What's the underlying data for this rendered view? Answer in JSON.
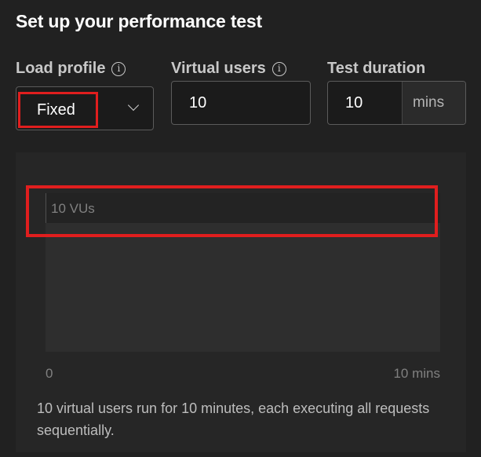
{
  "header": {
    "title": "Set up your performance test"
  },
  "load_profile": {
    "label": "Load profile",
    "info_icon": "info-icon",
    "selected": "Fixed",
    "dropdown_icon": "chevron-down-icon"
  },
  "virtual_users": {
    "label": "Virtual users",
    "info_icon": "info-icon",
    "value": "10"
  },
  "test_duration": {
    "label": "Test duration",
    "value": "10",
    "unit": "mins"
  },
  "chart": {
    "vu_label": "10 VUs",
    "x_start": "0",
    "x_end": "10 mins"
  },
  "description": "10 virtual users run for 10 minutes, each executing all requests sequentially.",
  "colors": {
    "background": "#212121",
    "highlight": "#e01e1e"
  }
}
